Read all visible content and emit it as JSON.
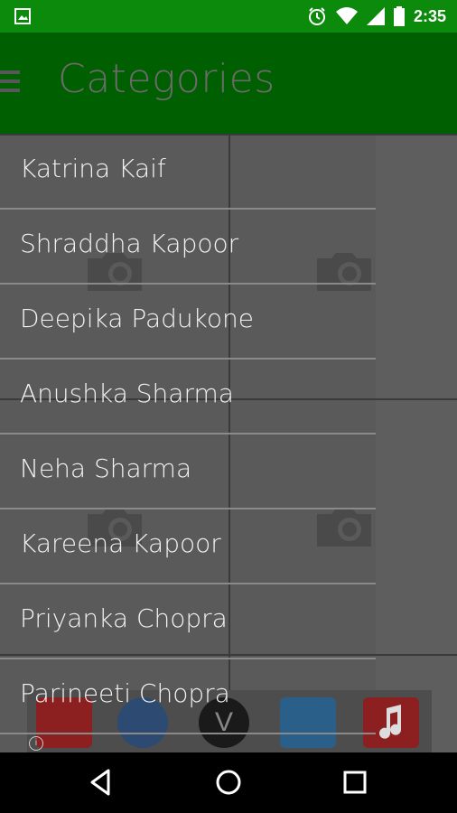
{
  "status_bar": {
    "time": "2:35",
    "icons": [
      "image-notification-icon",
      "alarm-icon",
      "wifi-icon",
      "signal-icon",
      "battery-icon"
    ],
    "color": "#0b8a0b"
  },
  "appbar": {
    "title": "Categories",
    "color": "#005f00"
  },
  "drawer": {
    "items": [
      {
        "label": "Katrina Kaif"
      },
      {
        "label": "Shraddha Kapoor"
      },
      {
        "label": "Deepika Padukone"
      },
      {
        "label": "Anushka Sharma"
      },
      {
        "label": "Neha Sharma"
      },
      {
        "label": "Kareena Kapoor"
      },
      {
        "label": "Priyanka Chopra"
      },
      {
        "label": "Parineeti Chopra"
      }
    ]
  },
  "ad": {
    "icons": [
      "app-icon-red",
      "app-icon-blue",
      "app-icon-v",
      "app-icon-box",
      "app-icon-music"
    ]
  },
  "navbar": {
    "icons": [
      "back-icon",
      "home-icon",
      "recents-icon"
    ]
  }
}
